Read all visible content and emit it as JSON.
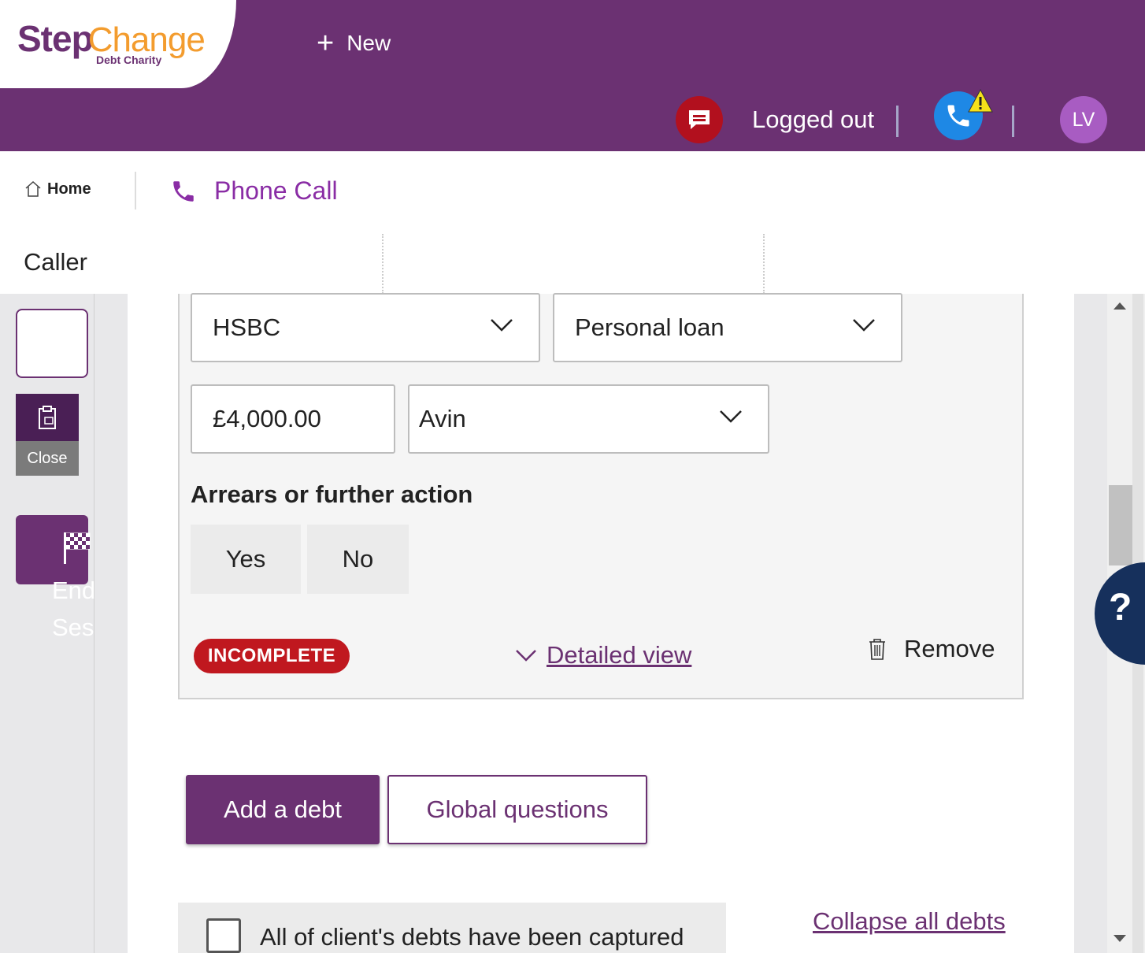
{
  "header": {
    "logo_step": "Step",
    "logo_change": "Change",
    "logo_sub": "Debt Charity",
    "new_label": "New",
    "chat_icon": "chat-bubble-icon",
    "status_label": "Logged out",
    "avatar_initials": "LV"
  },
  "breadcrumb": {
    "home_label": "Home",
    "phone_call_label": "Phone Call"
  },
  "tabs": {
    "caller_label": "Caller"
  },
  "sidebar": {
    "close_label": "Close",
    "end_session_label": "End\nSession"
  },
  "debt": {
    "creditor_value": "HSBC",
    "debt_type_value": "Personal loan",
    "amount_value": "£4,000.00",
    "owner_value": "Avin",
    "arrears_label": "Arrears or further action",
    "yes_label": "Yes",
    "no_label": "No",
    "status_badge": "INCOMPLETE",
    "detailed_view_label": "Detailed view",
    "remove_label": "Remove"
  },
  "actions": {
    "add_debt_label": "Add a debt",
    "global_questions_label": "Global questions"
  },
  "footer": {
    "captured_label": "All of client's debts have been captured",
    "collapse_label": "Collapse all debts"
  },
  "help_label": "?",
  "colors": {
    "brand_purple": "#6b3172",
    "brand_orange": "#f39c2e",
    "status_red": "#c0181f",
    "help_navy": "#16305c"
  }
}
